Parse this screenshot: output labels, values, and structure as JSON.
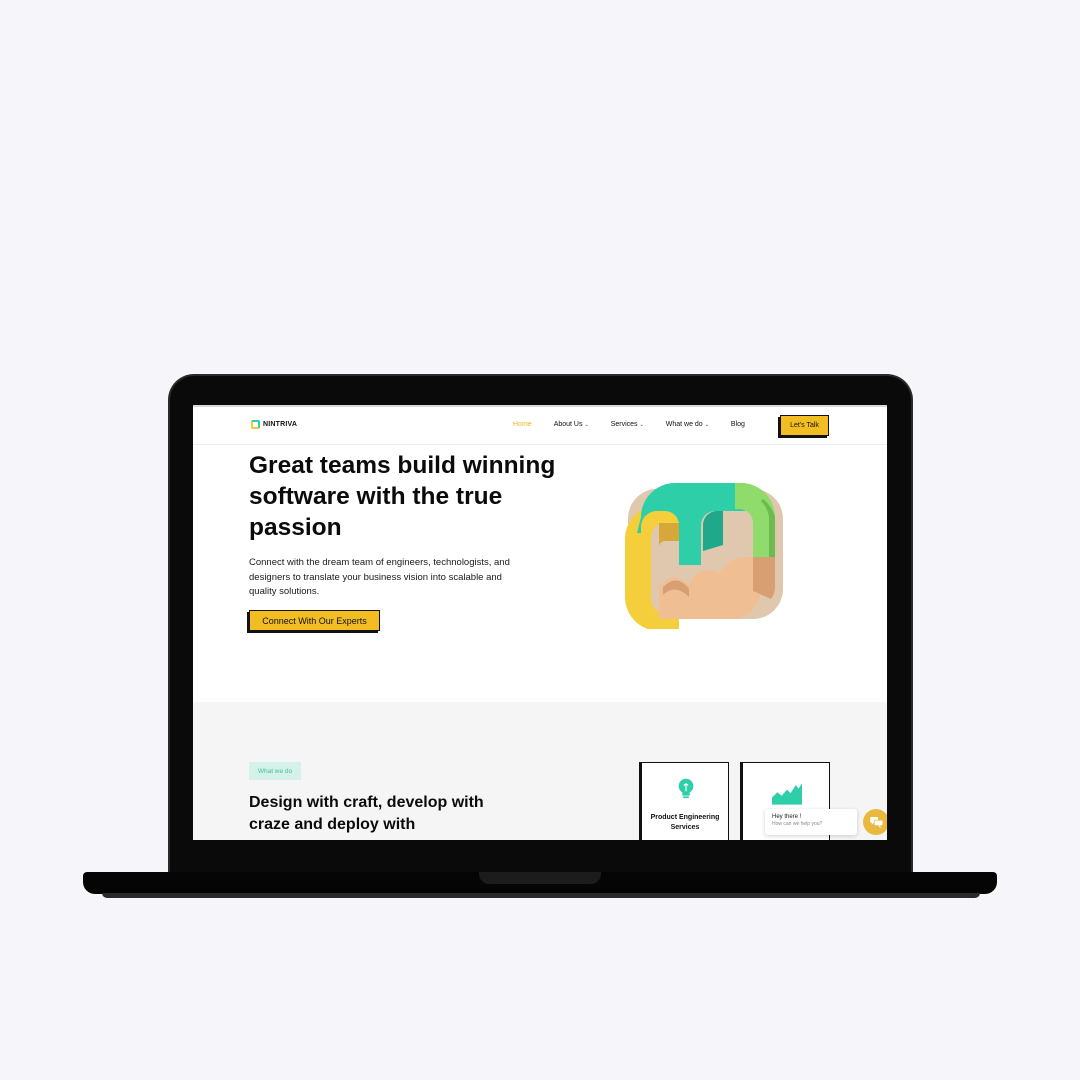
{
  "header": {
    "logo_text": "NINTRIVA",
    "nav": [
      {
        "label": "Home",
        "active": true,
        "dropdown": false
      },
      {
        "label": "About Us",
        "active": false,
        "dropdown": true
      },
      {
        "label": "Services",
        "active": false,
        "dropdown": true
      },
      {
        "label": "What we do",
        "active": false,
        "dropdown": true
      },
      {
        "label": "Blog",
        "active": false,
        "dropdown": false
      }
    ],
    "cta_label": "Let's Talk"
  },
  "hero": {
    "title": "Great teams build winning software with the true passion",
    "description": "Connect with the dream team of engineers, technologists, and designers to translate your business vision into scalable and quality solutions.",
    "button_label": "Connect With Our Experts"
  },
  "what_we_do": {
    "tag": "What we do",
    "title": "Design with craft, develop with craze and deploy with",
    "cards": [
      {
        "label": "Product Engineering Services",
        "icon": "lightbulb-icon"
      },
      {
        "label": "",
        "icon": "growth-chart-icon"
      }
    ]
  },
  "chat": {
    "greeting": "Hey there !",
    "subtext": "How can we help you?"
  },
  "colors": {
    "accent_yellow": "#f2bd22",
    "accent_teal": "#2ecfa8",
    "tag_bg": "#d5f2ea",
    "active_nav": "#f0b51f"
  }
}
